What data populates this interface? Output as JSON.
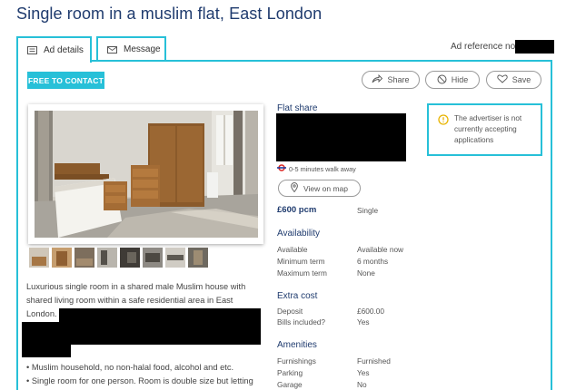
{
  "page": {
    "title": "Single room in a muslim flat, East London"
  },
  "tabs": [
    {
      "label": "Ad details",
      "icon": "list-icon"
    },
    {
      "label": "Message",
      "icon": "envelope-icon"
    }
  ],
  "reference": {
    "label": "Ad reference no."
  },
  "actions": {
    "contact_label": "FREE TO CONTACT",
    "share_label": "Share",
    "hide_label": "Hide",
    "save_label": "Save"
  },
  "description": {
    "intro": "Luxurious single room in a shared male Muslim house with shared living room within a safe residential area in East London.",
    "bullets": [
      "Muslim household, no non-halal food, alcohol and etc.",
      "Single room for one person. Room is double size but letting"
    ]
  },
  "details": {
    "type_heading": "Flat share",
    "walk_text": "0-5 minutes walk away",
    "map_button": "View on map",
    "price": "£600 pcm",
    "room_type": "Single",
    "availability": {
      "heading": "Availability",
      "rows": [
        {
          "key": "Available",
          "value": "Available now"
        },
        {
          "key": "Minimum term",
          "value": "6 months"
        },
        {
          "key": "Maximum term",
          "value": "None"
        }
      ]
    },
    "extra_cost": {
      "heading": "Extra cost",
      "rows": [
        {
          "key": "Deposit",
          "value": "£600.00"
        },
        {
          "key": "Bills included?",
          "value": "Yes"
        }
      ]
    },
    "amenities": {
      "heading": "Amenities",
      "rows": [
        {
          "key": "Furnishings",
          "value": "Furnished"
        },
        {
          "key": "Parking",
          "value": "Yes"
        },
        {
          "key": "Garage",
          "value": "No"
        }
      ]
    }
  },
  "notice": {
    "text": "The advertiser is not currently accepting applications",
    "icon": "warning-icon"
  },
  "colors": {
    "accent": "#27c0d8",
    "heading": "#1f3b6e",
    "notice_icon": "#e8b400",
    "underground": "#dc241f"
  }
}
